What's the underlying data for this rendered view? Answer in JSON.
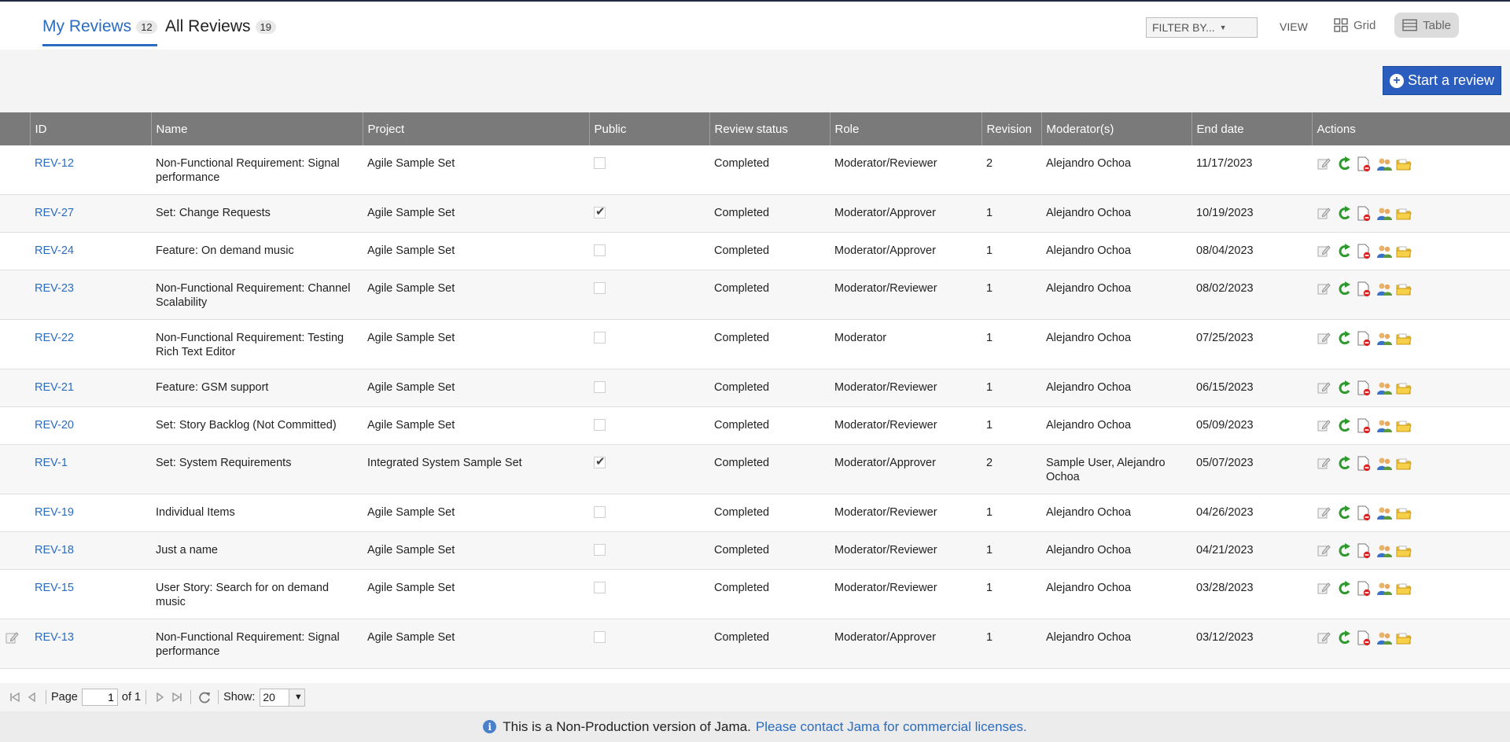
{
  "tabs": [
    {
      "label": "My Reviews",
      "count": "12"
    },
    {
      "label": "All Reviews",
      "count": "19"
    }
  ],
  "filter": {
    "label": "FILTER BY..."
  },
  "view": {
    "label": "VIEW",
    "grid": "Grid",
    "table": "Table"
  },
  "toolbar": {
    "start_label": "Start a review"
  },
  "columns": [
    "ID",
    "Name",
    "Project",
    "Public",
    "Review status",
    "Role",
    "Revision",
    "Moderator(s)",
    "End date",
    "Actions"
  ],
  "rows": [
    {
      "id": "REV-12",
      "name": "Non-Functional Requirement: Signal performance",
      "project": "Agile Sample Set",
      "public": false,
      "status": "Completed",
      "role": "Moderator/Reviewer",
      "revision": "2",
      "moderators": "Alejandro Ochoa",
      "end": "11/17/2023"
    },
    {
      "id": "REV-27",
      "name": "Set: Change Requests",
      "project": "Agile Sample Set",
      "public": true,
      "status": "Completed",
      "role": "Moderator/Approver",
      "revision": "1",
      "moderators": "Alejandro Ochoa",
      "end": "10/19/2023"
    },
    {
      "id": "REV-24",
      "name": "Feature: On demand music",
      "project": "Agile Sample Set",
      "public": false,
      "status": "Completed",
      "role": "Moderator/Approver",
      "revision": "1",
      "moderators": "Alejandro Ochoa",
      "end": "08/04/2023"
    },
    {
      "id": "REV-23",
      "name": "Non-Functional Requirement: Channel Scalability",
      "project": "Agile Sample Set",
      "public": false,
      "status": "Completed",
      "role": "Moderator/Reviewer",
      "revision": "1",
      "moderators": "Alejandro Ochoa",
      "end": "08/02/2023"
    },
    {
      "id": "REV-22",
      "name": "Non-Functional Requirement: Testing Rich Text Editor",
      "project": "Agile Sample Set",
      "public": false,
      "status": "Completed",
      "role": "Moderator",
      "revision": "1",
      "moderators": "Alejandro Ochoa",
      "end": "07/25/2023"
    },
    {
      "id": "REV-21",
      "name": "Feature: GSM support",
      "project": "Agile Sample Set",
      "public": false,
      "status": "Completed",
      "role": "Moderator/Reviewer",
      "revision": "1",
      "moderators": "Alejandro Ochoa",
      "end": "06/15/2023"
    },
    {
      "id": "REV-20",
      "name": "Set: Story Backlog (Not Committed)",
      "project": "Agile Sample Set",
      "public": false,
      "status": "Completed",
      "role": "Moderator/Reviewer",
      "revision": "1",
      "moderators": "Alejandro Ochoa",
      "end": "05/09/2023"
    },
    {
      "id": "REV-1",
      "name": "Set: System Requirements",
      "project": "Integrated System Sample Set",
      "public": true,
      "status": "Completed",
      "role": "Moderator/Approver",
      "revision": "2",
      "moderators": "Sample User, Alejandro Ochoa",
      "end": "05/07/2023"
    },
    {
      "id": "REV-19",
      "name": "Individual Items",
      "project": "Agile Sample Set",
      "public": false,
      "status": "Completed",
      "role": "Moderator/Reviewer",
      "revision": "1",
      "moderators": "Alejandro Ochoa",
      "end": "04/26/2023"
    },
    {
      "id": "REV-18",
      "name": "Just a name",
      "project": "Agile Sample Set",
      "public": false,
      "status": "Completed",
      "role": "Moderator/Reviewer",
      "revision": "1",
      "moderators": "Alejandro Ochoa",
      "end": "04/21/2023"
    },
    {
      "id": "REV-15",
      "name": "User Story: Search for on demand music",
      "project": "Agile Sample Set",
      "public": false,
      "status": "Completed",
      "role": "Moderator/Reviewer",
      "revision": "1",
      "moderators": "Alejandro Ochoa",
      "end": "03/28/2023"
    },
    {
      "id": "REV-13",
      "name": "Non-Functional Requirement: Signal performance",
      "project": "Agile Sample Set",
      "public": false,
      "status": "Completed",
      "role": "Moderator/Approver",
      "revision": "1",
      "moderators": "Alejandro Ochoa",
      "end": "03/12/2023"
    }
  ],
  "pager": {
    "page_label": "Page",
    "page_value": "1",
    "of_label": "of 1",
    "show_label": "Show:",
    "show_value": "20"
  },
  "footer": {
    "notice": "This is a Non-Production version of Jama.",
    "link": "Please contact Jama for commercial licenses."
  },
  "colors": {
    "accent": "#2a6cc0",
    "header_bg": "#7a7a7a",
    "button_bg": "#2a5dbd"
  }
}
